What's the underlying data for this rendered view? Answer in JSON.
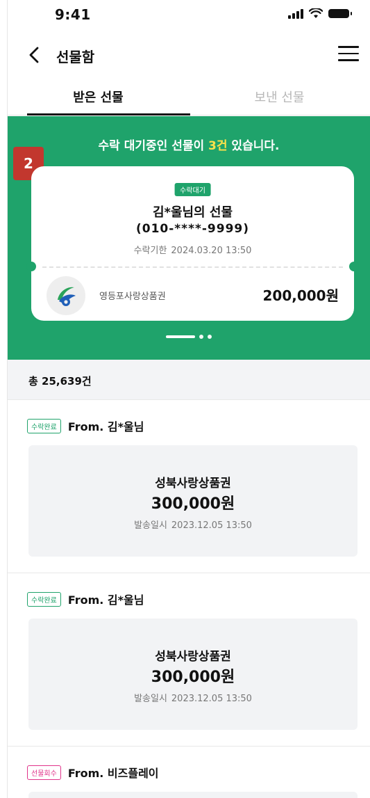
{
  "status_bar": {
    "time": "9:41"
  },
  "header": {
    "title": "선물함",
    "back_icon": "chevron-left-icon",
    "menu_icon": "hamburger-menu-icon"
  },
  "tabs": [
    {
      "label": "받은 선물",
      "active": true
    },
    {
      "label": "보낸 선물",
      "active": false
    }
  ],
  "banner": {
    "message_prefix": "수락 대기중인 선물이 ",
    "message_highlight": "3건",
    "message_suffix": " 있습니다.",
    "badge_number": "2",
    "highlight_color": "#ffe24a",
    "background_color": "#1fa36b"
  },
  "pending_card": {
    "status_label": "수락대기",
    "sender_title": "김*울님의 선물",
    "sender_phone": "(010-****-9999)",
    "deadline_label": "수락기한",
    "deadline_value": "2024.03.20 13:50",
    "voucher_name": "영등포사랑상품권",
    "amount": "200,000원"
  },
  "pager": {
    "total_pages": 3,
    "current_page": 1
  },
  "total": {
    "label": "총 25,639건"
  },
  "items": [
    {
      "status": "수락완료",
      "status_type": "done",
      "from": "From. 김*울님",
      "voucher_name": "성북사랑상품권",
      "amount": "300,000원",
      "date_label": "발송일시",
      "date_value": "2023.12.05 13:50"
    },
    {
      "status": "수락완료",
      "status_type": "done",
      "from": "From. 김*울님",
      "voucher_name": "성북사랑상품권",
      "amount": "300,000원",
      "date_label": "발송일시",
      "date_value": "2023.12.05 13:50"
    },
    {
      "status": "선물회수",
      "status_type": "recall",
      "from": "From. 비즈플레이"
    }
  ]
}
